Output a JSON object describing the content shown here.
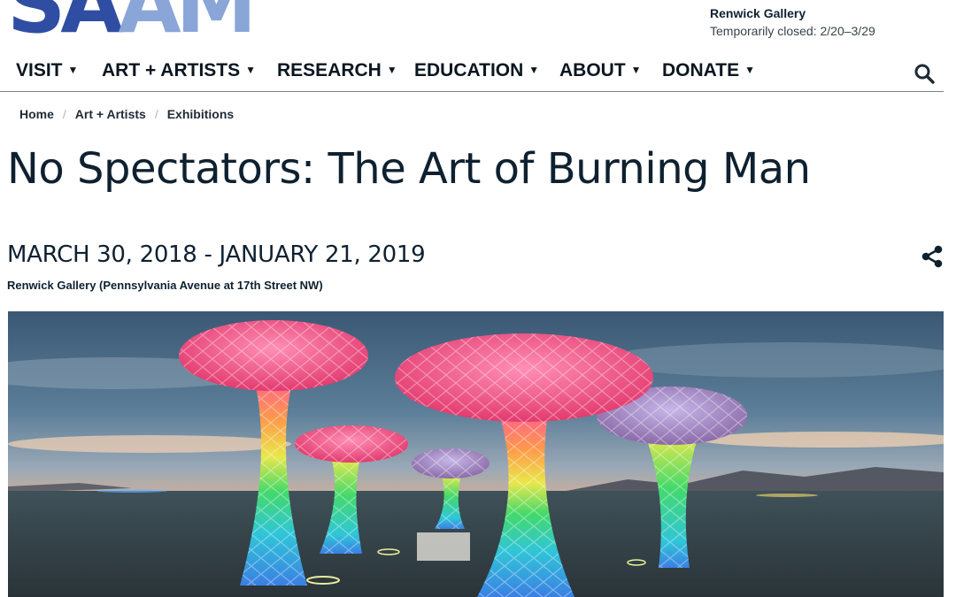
{
  "header": {
    "logo_part1": "SA",
    "logo_part2": "AM",
    "gallery_name": "Renwick Gallery",
    "gallery_status": "Temporarily closed: 2/20–3/29"
  },
  "nav": {
    "items": [
      {
        "label": "VISIT"
      },
      {
        "label": "ART + ARTISTS"
      },
      {
        "label": "RESEARCH"
      },
      {
        "label": "EDUCATION"
      },
      {
        "label": "ABOUT"
      },
      {
        "label": "DONATE"
      }
    ],
    "caret_glyph": "▼",
    "search_icon": "search-icon"
  },
  "breadcrumb": [
    "Home",
    "Art + Artists",
    "Exhibitions"
  ],
  "breadcrumb_separator": "/",
  "exhibition": {
    "title": "No Spectators: The Art of Burning Man",
    "dates": "MARCH 30, 2018 - JANUARY 21, 2019",
    "location": "Renwick Gallery (Pennsylvania Avenue at 17th Street NW)",
    "share_icon": "share-icon"
  },
  "hero": {
    "description_icon": "hero-image",
    "colors": {
      "sky_top": "#3d5d7a",
      "sky_glow": "#f1a777",
      "ground": "#324249"
    }
  }
}
